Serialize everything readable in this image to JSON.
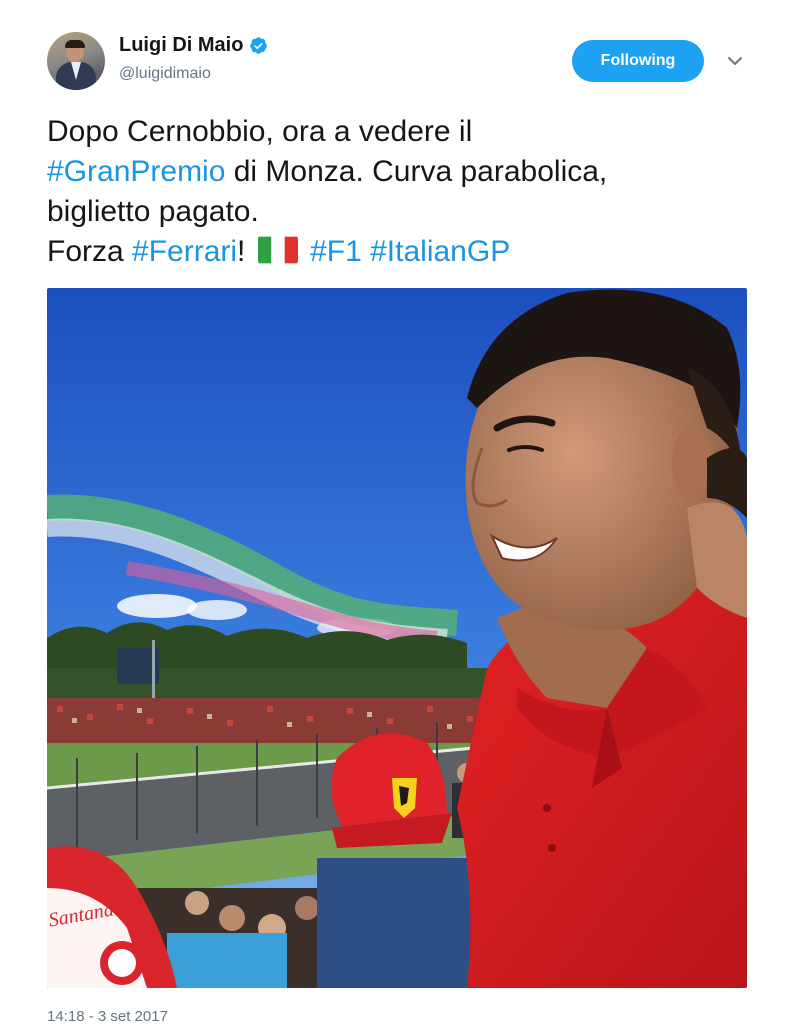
{
  "header": {
    "display_name": "Luigi Di Maio",
    "handle": "@luigidimaio",
    "follow_button_label": "Following",
    "avatar_icon": "user-avatar",
    "verified_icon": "verified-badge-icon",
    "more_icon": "chevron-down-icon"
  },
  "tweet": {
    "line1": "Dopo Cernobbio, ora a vedere il",
    "hashtag_granpremio": "#GranPremio",
    "line2_rest": " di Monza. Curva parabolica,",
    "line3": "biglietto pagato.",
    "line4_prefix": "Forza ",
    "hashtag_ferrari": "#Ferrari",
    "line4_bang": "!",
    "hashtag_f1": "#F1",
    "hashtag_italiangp": "#ItalianGP",
    "flag_icon": "italy-flag-icon"
  },
  "photo": {
    "cap_text": "Santander"
  },
  "timestamp": "14:18 - 3 set 2017",
  "colors": {
    "accent": "#1da1f2",
    "hashtag": "#1b95e0",
    "text": "#14171a",
    "secondary": "#657786"
  }
}
